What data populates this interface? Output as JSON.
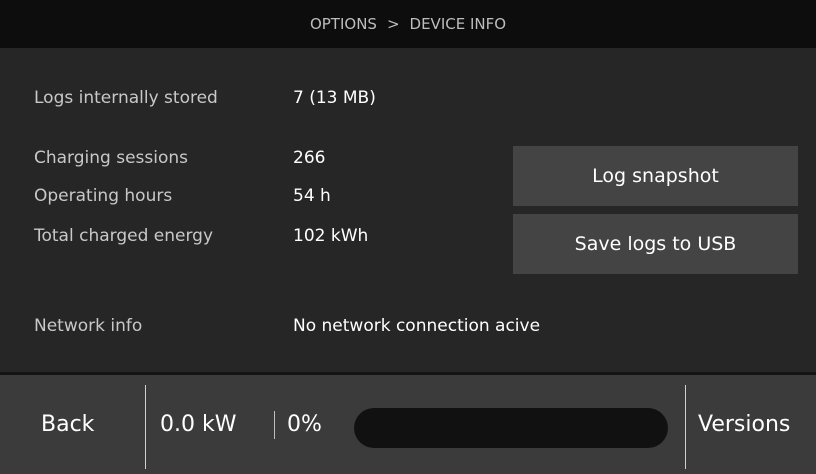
{
  "header": {
    "breadcrumb_root": "OPTIONS",
    "separator": ">",
    "breadcrumb_current": "DEVICE INFO"
  },
  "info": {
    "logs_label": "Logs internally stored",
    "logs_value": "7 (13 MB)",
    "sessions_label": "Charging sessions",
    "sessions_value": "266",
    "hours_label": "Operating hours",
    "hours_value": "54 h",
    "energy_label": "Total charged energy",
    "energy_value": "102 kWh",
    "network_label": "Network info",
    "network_value": "No network connection acive"
  },
  "buttons": {
    "log_snapshot": "Log snapshot",
    "save_logs": "Save logs to USB"
  },
  "footer": {
    "back_label": "Back",
    "power": "0.0 kW",
    "percent": "0%",
    "progress_fraction": 0,
    "versions_label": "Versions"
  },
  "colors": {
    "header_bg": "#0d0d0d",
    "main_bg": "#262626",
    "button_bg": "#444444",
    "footer_bg": "#3b3b3b",
    "progress_track": "#111111"
  }
}
